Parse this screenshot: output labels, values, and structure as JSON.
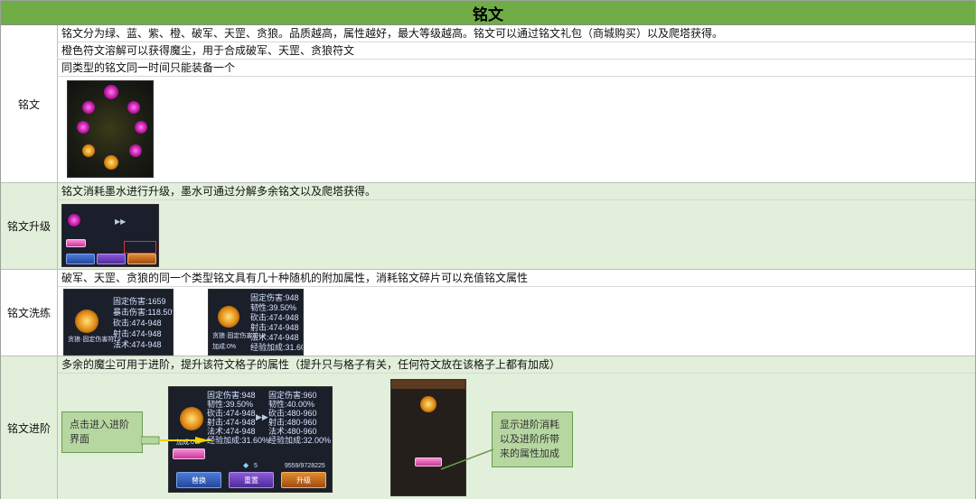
{
  "title": "铭文",
  "sections": {
    "inscription": {
      "label": "铭文",
      "lines": [
        "铭文分为绿、蓝、紫、橙、破军、天罡、贪狼。品质越高，属性越好，最大等级越高。铭文可以通过铭文礼包（商城购买）以及爬塔获得。",
        "橙色符文溶解可以获得魔尘，用于合成破军、天罡、贪狼符文",
        "同类型的铭文同一时间只能装备一个"
      ]
    },
    "upgrade": {
      "label": "铭文升级",
      "lines": [
        "铭文消耗墨水进行升级，墨水可通过分解多余铭文以及爬塔获得。"
      ]
    },
    "refine": {
      "label": "铭文洗练",
      "lines": [
        "破军、天罡、贪狼的同一个类型铭文具有几十种随机的附加属性，消耗铭文碎片可以充值铭文属性"
      ],
      "shot1_stats": [
        "固定伤害:1659",
        "暴击伤害:118.50%",
        "砍击:474-948",
        "射击:474-948",
        "法术:474-948"
      ],
      "shot2_stats": [
        "固定伤害:948",
        "韧性:39.50%",
        "砍击:474-948",
        "射击:474-948",
        "法术:474-948",
        "经验加成:31.60%"
      ],
      "shot1_caption": "贪狼·固定伤害符Lv",
      "shot2_caption": "贪狼·固定伤害符Lv",
      "shot2_bonus": "加成:0%"
    },
    "advance": {
      "label": "铭文进阶",
      "lines": [
        "多余的魔尘可用于进阶，提升该符文格子的属性（提升只与格子有关，任何符文放在该格子上都有加成）"
      ],
      "left_stats": [
        "固定伤害:948",
        "韧性:39.50%",
        "砍击:474-948",
        "射击:474-948",
        "法术:474-948",
        "经验加成:31.60%"
      ],
      "right_stats": [
        "固定伤害:960",
        "韧性:40.00%",
        "砍击:480-960",
        "射击:480-960",
        "法术:480-960",
        "经验加成:32.00%"
      ],
      "bonus": "加成:0%",
      "gem_count": "5",
      "currency": "9559/9728225",
      "buttons": {
        "replace": "替换",
        "reset": "重置",
        "upgrade": "升级"
      },
      "callout_left": "点击进入进阶界面",
      "callout_right": "显示进阶消耗以及进阶所带来的属性加成"
    }
  },
  "colors": {
    "header_green": "#70ad47",
    "band_green": "#e2efda",
    "callout_green": "#b6d7a0"
  }
}
